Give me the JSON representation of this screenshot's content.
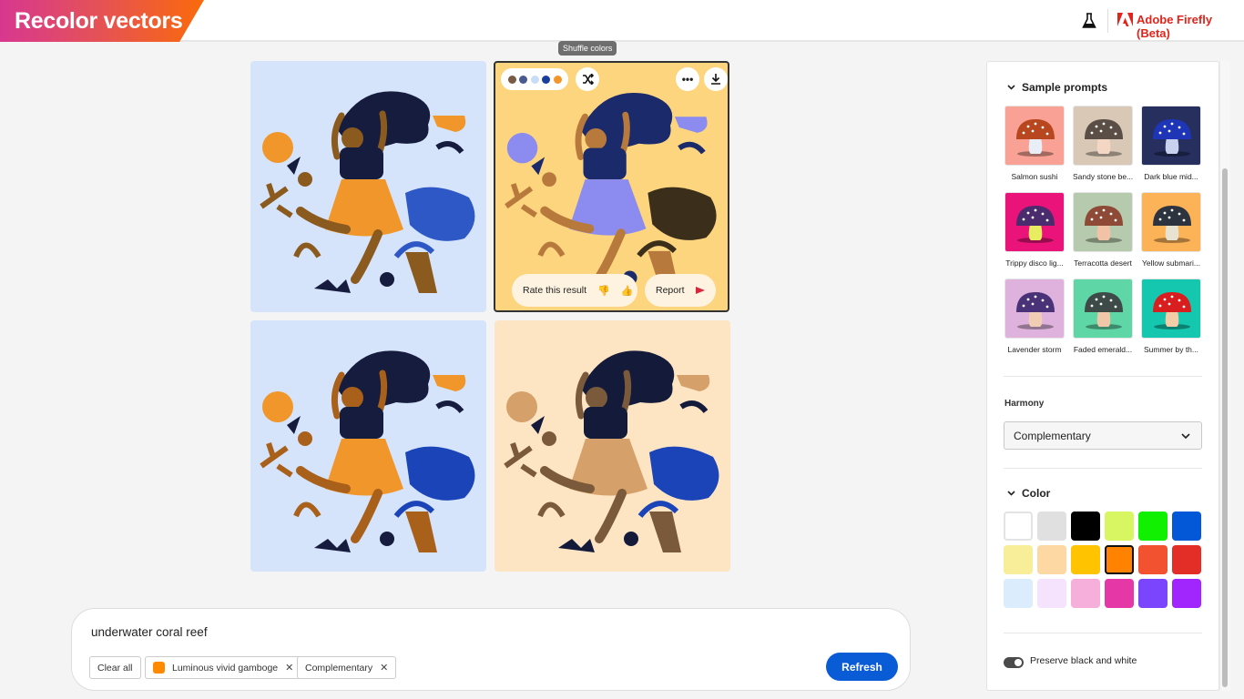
{
  "header": {
    "page_title": "Recolor vectors",
    "brand": "Adobe Firefly (Beta)",
    "lab_icon": "beaker-icon",
    "logo_icon": "adobe-logo-icon"
  },
  "results": {
    "tooltip": "Shuffle colors",
    "selected_palette": [
      "#7a5a44",
      "#4a5a8f",
      "#c8dcf6",
      "#1a3f9a",
      "#f0962a"
    ],
    "shuffle_icon": "shuffle-icon",
    "more_icon": "more-options-icon",
    "download_icon": "download-icon",
    "rate_label": "Rate this result",
    "report_label": "Report",
    "cards": [
      {
        "name": "result-1",
        "bg": "#d6e4fb",
        "c1": "#f0962a",
        "c2": "#151c3e",
        "c3": "#8b5a1e",
        "c4": "#2d58c6"
      },
      {
        "name": "result-2",
        "bg": "#fdd57e",
        "c1": "#8c8cf0",
        "c2": "#1a2a6a",
        "c3": "#b87a3c",
        "c4": "#3b2f1c"
      },
      {
        "name": "result-3",
        "bg": "#d6e4fb",
        "c1": "#f0962a",
        "c2": "#151c3e",
        "c3": "#a8601a",
        "c4": "#1a44b8"
      },
      {
        "name": "result-4",
        "bg": "#fde5c3",
        "c1": "#d6a06a",
        "c2": "#141a3a",
        "c3": "#7a5a3a",
        "c4": "#1a44b8"
      }
    ]
  },
  "prompt": {
    "text": "underwater coral reef",
    "clear_all": "Clear all",
    "chips": [
      {
        "label": "Luminous vivid gamboge",
        "swatch": "#ff8a00"
      },
      {
        "label": "Complementary"
      }
    ],
    "refresh_label": "Refresh"
  },
  "panel": {
    "sample_prompts_title": "Sample prompts",
    "sample_prompts": [
      {
        "label": "Salmon sushi",
        "bg": "#f9a195",
        "cap": "#b8461e",
        "stem": "#e9eef6"
      },
      {
        "label": "Sandy stone be...",
        "bg": "#d9c8b6",
        "cap": "#5a4e46",
        "stem": "#f3d6c4"
      },
      {
        "label": "Dark blue mid...",
        "bg": "#262f5e",
        "cap": "#1f35b8",
        "stem": "#c8d2ee"
      },
      {
        "label": "Trippy disco lig...",
        "bg": "#ea137a",
        "cap": "#4a2c6e",
        "stem": "#e8ec60"
      },
      {
        "label": "Terracotta desert",
        "bg": "#b6cbad",
        "cap": "#8e4a36",
        "stem": "#f2c2a6"
      },
      {
        "label": "Yellow submari...",
        "bg": "#fcb257",
        "cap": "#2e3340",
        "stem": "#e8e2d2"
      },
      {
        "label": "Lavender storm",
        "bg": "#deb2dd",
        "cap": "#4a3278",
        "stem": "#f0cdb4"
      },
      {
        "label": "Faded emerald...",
        "bg": "#5fd6a6",
        "cap": "#3d4a48",
        "stem": "#f0c7a8"
      },
      {
        "label": "Summer by th...",
        "bg": "#14c7ae",
        "cap": "#d81e1e",
        "stem": "#f2cda8"
      }
    ],
    "harmony_label": "Harmony",
    "harmony_value": "Complementary",
    "color_title": "Color",
    "colors": [
      "#ffffff",
      "#e0e0e0",
      "#000000",
      "#d8f562",
      "#10f000",
      "#0358d8",
      "#f8ee9a",
      "#fdd8a2",
      "#ffc300",
      "#ff8200",
      "#f25230",
      "#e22e26",
      "#dbedfd",
      "#f5e2fc",
      "#f6aedb",
      "#e538a6",
      "#7b44fd",
      "#a026fd"
    ],
    "selected_color_index": 9,
    "preserve_label": "Preserve black and white",
    "preserve_on": true
  }
}
